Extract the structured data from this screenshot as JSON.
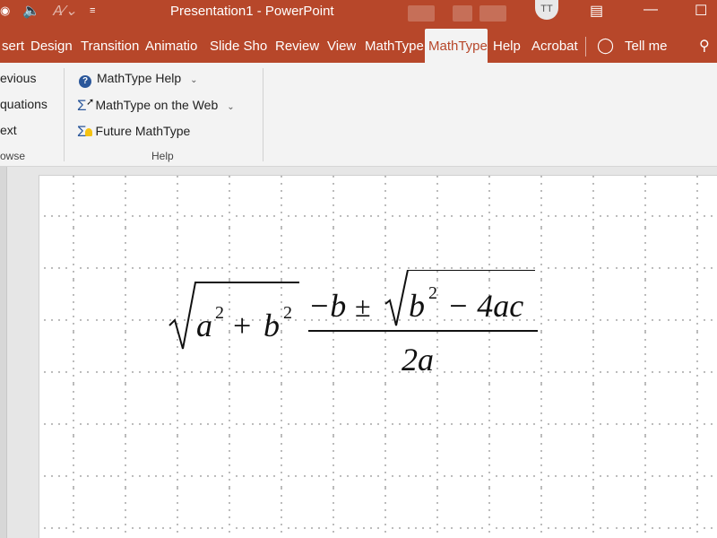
{
  "app": {
    "title": "Presentation1  -  PowerPoint",
    "account_initials": "TT",
    "accent_color": "#b7472a"
  },
  "quick_access": {
    "icons": [
      "present-icon",
      "speaker-icon",
      "font-size-icon",
      "qat-dropdown-icon"
    ]
  },
  "tabs": [
    {
      "label": "sert"
    },
    {
      "label": "Design"
    },
    {
      "label": "Transition"
    },
    {
      "label": "Animatio"
    },
    {
      "label": "Slide Sho"
    },
    {
      "label": "Review"
    },
    {
      "label": "View"
    },
    {
      "label": "MathType"
    },
    {
      "label": "MathType",
      "active": true
    },
    {
      "label": "Help"
    },
    {
      "label": "Acrobat"
    },
    {
      "label": "Tell me"
    }
  ],
  "ribbon": {
    "browse_group": {
      "items": [
        "evious",
        "quations",
        "ext"
      ],
      "label": "owse"
    },
    "help_group": {
      "items": [
        "MathType Help",
        "MathType on the Web",
        "Future MathType"
      ],
      "label": "Help"
    }
  },
  "equation": {
    "radicand_a": "a",
    "radicand_a_exp": "2",
    "radicand_plus": "+",
    "radicand_b": "b",
    "radicand_b_exp": "2",
    "num_minus_b": "−b",
    "num_pm": "±",
    "inner_b": "b",
    "inner_b_exp": "2",
    "inner_rest": "− 4ac",
    "denominator": "2a"
  }
}
